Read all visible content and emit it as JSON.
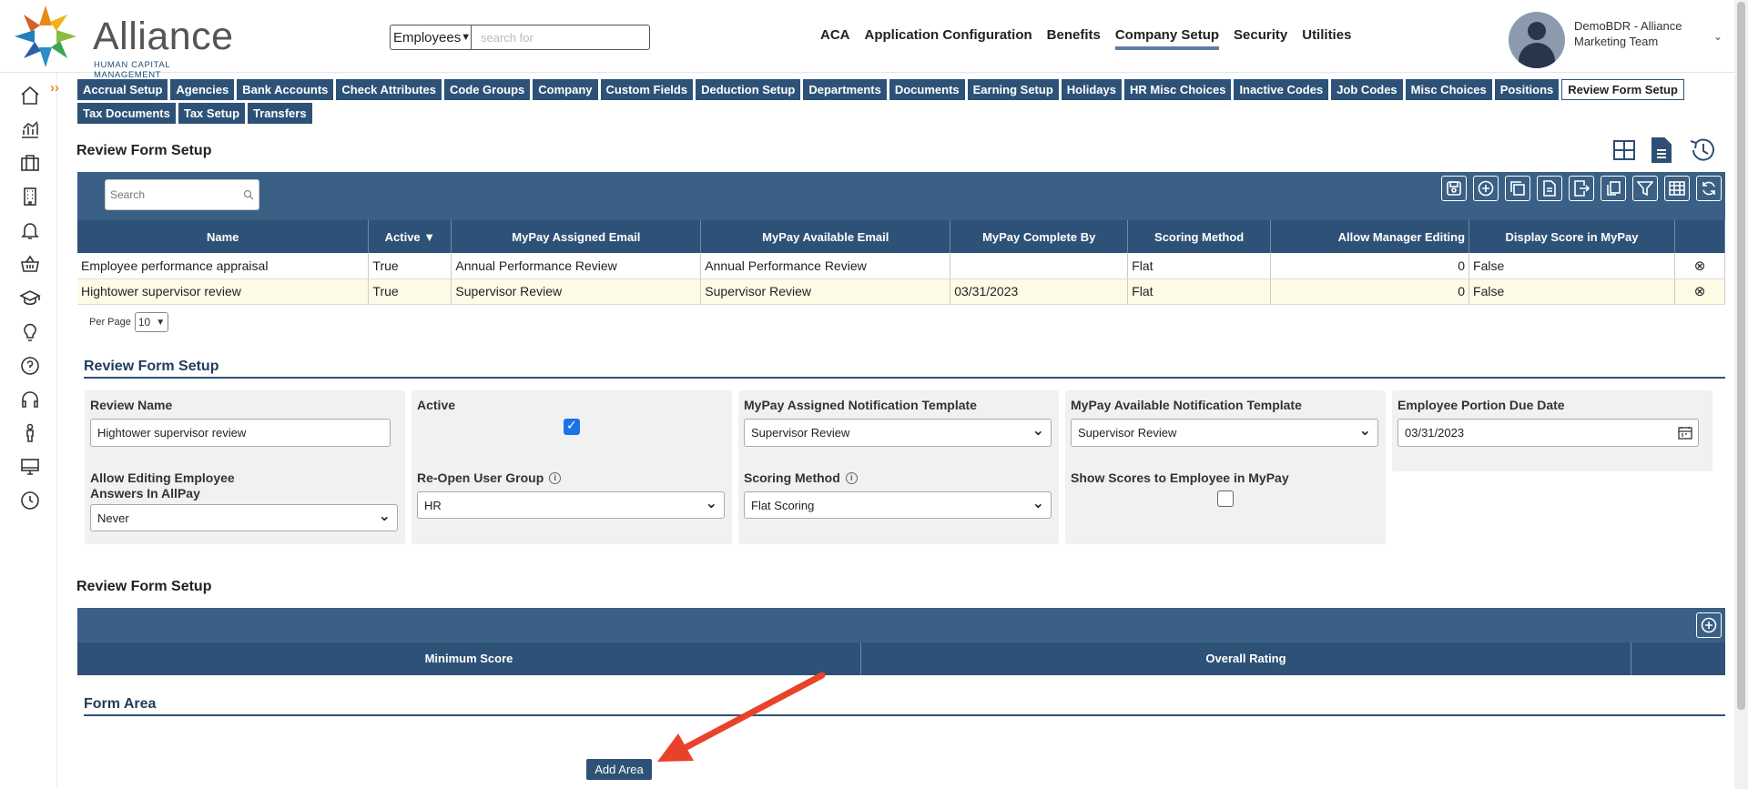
{
  "app": {
    "logo_text": "Alliance",
    "logo_sub": "HUMAN CAPITAL MANAGEMENT"
  },
  "search": {
    "scope": "Employees",
    "placeholder": "search for"
  },
  "nav": {
    "items": [
      "ACA",
      "Application Configuration",
      "Benefits",
      "Company Setup",
      "Security",
      "Utilities"
    ],
    "active": "Company Setup"
  },
  "user": {
    "name": "DemoBDR - Alliance Marketing Team"
  },
  "subnav": {
    "tabs": [
      "Accrual Setup",
      "Agencies",
      "Bank Accounts",
      "Check Attributes",
      "Code Groups",
      "Company",
      "Custom Fields",
      "Deduction Setup",
      "Departments",
      "Documents",
      "Earning Setup",
      "Holidays",
      "HR Misc Choices",
      "Inactive Codes",
      "Job Codes",
      "Misc Choices",
      "Positions",
      "Review Form Setup",
      "Tax Documents",
      "Tax Setup",
      "Transfers"
    ],
    "active": "Review Form Setup"
  },
  "page": {
    "title": "Review Form Setup"
  },
  "grid": {
    "search_placeholder": "Search",
    "columns": [
      "Name",
      "Active ▼",
      "MyPay Assigned Email",
      "MyPay Available Email",
      "MyPay Complete By",
      "Scoring Method",
      "Allow Manager Editing",
      "Display Score in MyPay"
    ],
    "rows": [
      [
        "Employee performance appraisal",
        "True",
        "Annual Performance Review",
        "Annual Performance Review",
        "",
        "Flat",
        "0",
        "False"
      ],
      [
        "Hightower supervisor review",
        "True",
        "Supervisor Review",
        "Supervisor Review",
        "03/31/2023",
        "Flat",
        "0",
        "False"
      ]
    ],
    "per_page_label": "Per Page",
    "per_page_value": "10"
  },
  "form": {
    "title": "Review Form Setup",
    "review_name_label": "Review Name",
    "review_name_value": "Hightower supervisor review",
    "active_label": "Active",
    "active_checked": true,
    "assigned_tpl_label": "MyPay Assigned Notification Template",
    "assigned_tpl_value": "Supervisor Review",
    "available_tpl_label": "MyPay Available Notification Template",
    "available_tpl_value": "Supervisor Review",
    "due_date_label": "Employee Portion Due Date",
    "due_date_value": "03/31/2023",
    "allow_edit_label": "Allow Editing Employee Answers In AllPay",
    "allow_edit_value": "Never",
    "reopen_label": "Re-Open User Group",
    "reopen_value": "HR",
    "scoring_label": "Scoring Method",
    "scoring_value": "Flat Scoring",
    "show_scores_label": "Show Scores to Employee in MyPay",
    "show_scores_checked": false
  },
  "scores": {
    "title": "Review Form Setup",
    "col_min": "Minimum Score",
    "col_rating": "Overall Rating"
  },
  "form_area": {
    "title": "Form Area",
    "add_button": "Add Area"
  },
  "colors": {
    "header_blue": "#2e5277",
    "toolbar_blue": "#3a6085",
    "accent_orange": "#e8891a",
    "delete_red": "#e0302c",
    "arrow_red": "#e8432a"
  }
}
